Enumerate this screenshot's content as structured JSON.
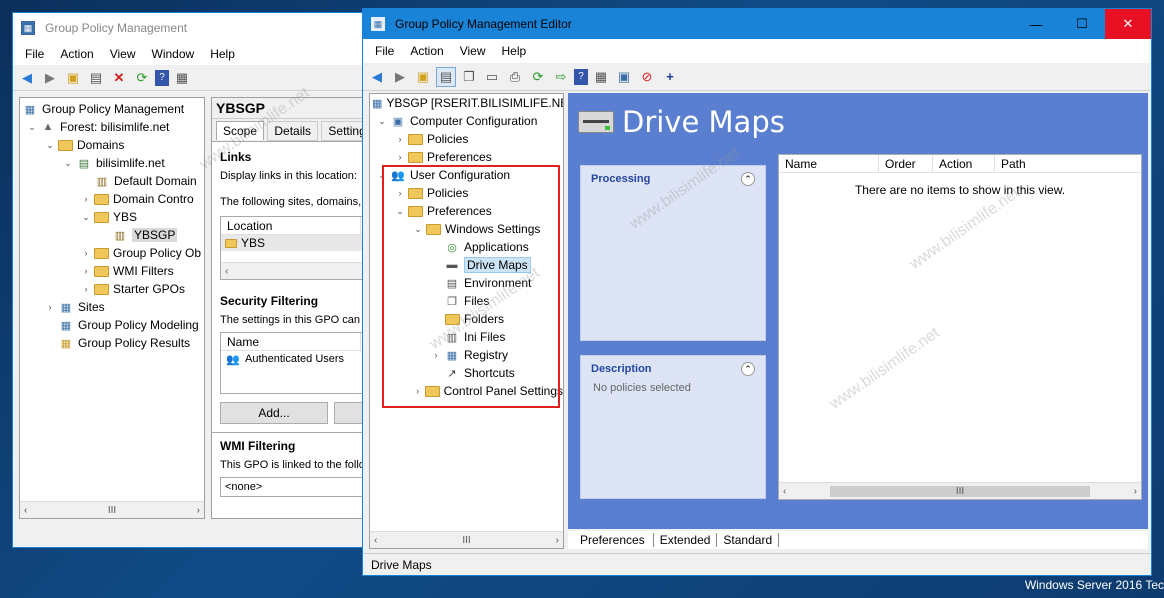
{
  "back_window": {
    "title": "Group Policy Management",
    "menu": [
      "File",
      "Action",
      "View",
      "Window",
      "Help"
    ],
    "tree": {
      "root": "Group Policy Management",
      "forest": "Forest: bilisimlife.net",
      "domains": "Domains",
      "domain": "bilisimlife.net",
      "default_domain": "Default Domain",
      "domain_controllers": "Domain Contro",
      "ybs": "YBS",
      "ybsgp": "YBSGP",
      "gp_objects": "Group Policy Ob",
      "wmi_filters": "WMI Filters",
      "starter_gpos": "Starter GPOs",
      "sites": "Sites",
      "modeling": "Group Policy Modeling",
      "results": "Group Policy Results"
    },
    "detail": {
      "title": "YBSGP",
      "tabs": [
        "Scope",
        "Details",
        "Settings"
      ],
      "links_heading": "Links",
      "links_text": "Display links in this location:",
      "links_text2": "The following sites, domains,",
      "location_col": "Location",
      "location_value": "YBS",
      "security_heading": "Security Filtering",
      "security_text": "The settings in this GPO can",
      "name_col": "Name",
      "name_value": "Authenticated Users",
      "add_button": "Add...",
      "wmi_heading": "WMI Filtering",
      "wmi_text": "This GPO is linked to the follo",
      "wmi_select": "<none>"
    }
  },
  "editor": {
    "title": "Group Policy Management Editor",
    "menu": [
      "File",
      "Action",
      "View",
      "Help"
    ],
    "tree": {
      "root": "YBSGP [RSERIT.BILISIMLIFE.NET",
      "computer_config": "Computer Configuration",
      "cc_policies": "Policies",
      "cc_preferences": "Preferences",
      "user_config": "User Configuration",
      "uc_policies": "Policies",
      "uc_preferences": "Preferences",
      "windows_settings": "Windows Settings",
      "applications": "Applications",
      "drive_maps": "Drive Maps",
      "environment": "Environment",
      "files": "Files",
      "folders": "Folders",
      "ini_files": "Ini Files",
      "registry": "Registry",
      "shortcuts": "Shortcuts",
      "control_panel": "Control Panel Settings"
    },
    "content": {
      "heading": "Drive Maps",
      "processing_title": "Processing",
      "description_title": "Description",
      "description_text": "No policies selected",
      "columns": [
        "Name",
        "Order",
        "Action",
        "Path"
      ],
      "empty_text": "There are no items to show in this view.",
      "bottom_tabs": [
        "Preferences",
        "Extended",
        "Standard"
      ]
    },
    "status": "Drive Maps"
  },
  "taskbar_text": "Windows Server 2016 Tec",
  "watermark": "www.bilisimlife.net",
  "colors": {
    "accent": "#1883d7",
    "highlight_box": "#e02020",
    "content_bg": "#5a7fd0"
  }
}
